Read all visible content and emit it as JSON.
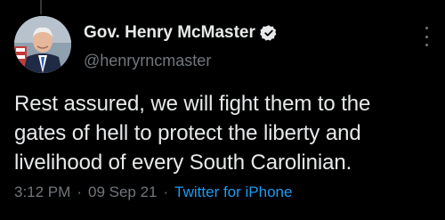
{
  "tweet": {
    "author": {
      "display_name": "Gov. Henry McMaster",
      "handle": "@henryrncmaster",
      "verified": true,
      "avatar_icon": "profile-photo-avatar"
    },
    "more_icon": "more-vertical-icon",
    "text_lines": [
      "Rest assured, we will fight them to the",
      "gates of hell to protect the liberty and",
      "livelihood of every South Carolinian."
    ],
    "time": "3:12 PM",
    "separator": "·",
    "date": "09 Sep 21",
    "source": "Twitter for iPhone"
  },
  "colors": {
    "background": "#000000",
    "text": "#e7e9ea",
    "secondary": "#71767b",
    "accent": "#1d9bf0"
  }
}
